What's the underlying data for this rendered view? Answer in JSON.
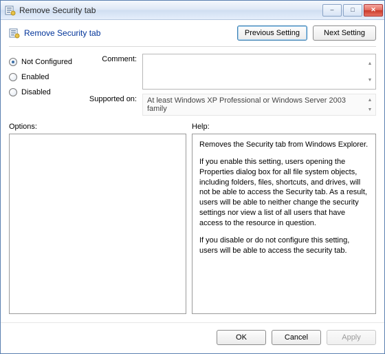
{
  "window": {
    "title": "Remove Security tab"
  },
  "header": {
    "policy_name": "Remove Security tab",
    "prev_label": "Previous Setting",
    "next_label": "Next Setting"
  },
  "state": {
    "not_configured": "Not Configured",
    "enabled": "Enabled",
    "disabled": "Disabled",
    "selected": "not_configured"
  },
  "form": {
    "comment_label": "Comment:",
    "comment_value": "",
    "supported_label": "Supported on:",
    "supported_value": "At least Windows XP Professional or Windows Server 2003 family"
  },
  "panes": {
    "options_label": "Options:",
    "help_label": "Help:"
  },
  "help": {
    "p1": "Removes the Security tab from Windows Explorer.",
    "p2": "If you enable this setting, users opening the Properties dialog box for all file system objects, including folders, files, shortcuts, and drives, will not be able to access the Security tab. As a result, users will be able to neither change the security settings nor view a list of all users that have access to the resource in question.",
    "p3": "If you disable or do not configure this setting, users will be able to access the security tab."
  },
  "buttons": {
    "ok": "OK",
    "cancel": "Cancel",
    "apply": "Apply"
  },
  "icons": {
    "app": "policy-icon",
    "minimize": "–",
    "maximize": "□",
    "close": "✕",
    "up": "▲",
    "down": "▼"
  }
}
